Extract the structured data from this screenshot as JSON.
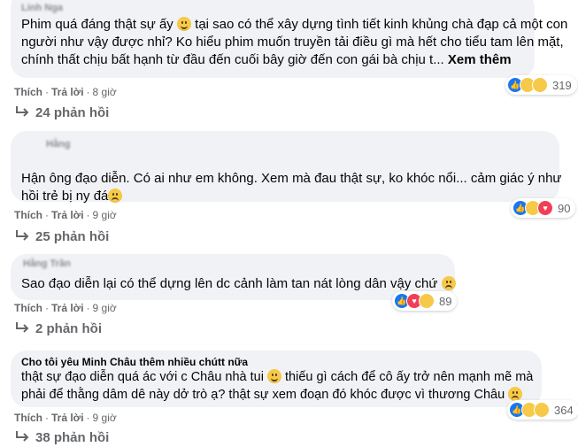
{
  "comments": [
    {
      "author": "Linh Nga",
      "author_blurred": true,
      "text_lines": [
        "Phim quá đáng thật sự ấy",
        "tại sao có thể xây dựng tình tiết kinh khủng chà đạp cả một con",
        "người như vậy được nhỉ? Ko hiểu phim muốn truyền tải điều gì mà hết cho tiểu tam lên mặt,",
        "chính thất chịu bất hạnh từ đầu đến cuối bây giờ đến con gái bà chịu t..."
      ],
      "see_more": "Xem thêm",
      "like_label": "Thích",
      "reply_label": "Trả lời",
      "time": "8 giờ",
      "reaction_count": "319",
      "reaction_types": [
        "like",
        "haha",
        "sad"
      ],
      "replies_label": "24 phản hồi"
    },
    {
      "author": "Hằng",
      "author_blurred": true,
      "text_lines": [
        "Hận ông đạo diễn. Có ai như em không. Xem mà đau thật sự, ko khóc nổi... cảm giác ý như",
        "hồi trẻ bị ny đá"
      ],
      "like_label": "Thích",
      "reply_label": "Trả lời",
      "time": "9 giờ",
      "reaction_count": "90",
      "reaction_types": [
        "like",
        "sad",
        "love"
      ],
      "replies_label": "25 phản hồi"
    },
    {
      "author": "Hằng Trần",
      "author_blurred": true,
      "text_lines": [
        "Sao đạo diễn lại có thể dựng lên dc cảnh làm tan nát lòng dân vậy chứ"
      ],
      "like_label": "Thích",
      "reply_label": "Trả lời",
      "time": "9 giờ",
      "reaction_count": "89",
      "reaction_types": [
        "like",
        "love",
        "sad"
      ],
      "replies_label": "2 phản hồi"
    },
    {
      "author": "Cho tôi yêu Minh Châu thêm nhiều chútt nữa",
      "author_blurred": false,
      "text_lines": [
        "thật sự đạo diễn quá ác với c Châu nhà tui",
        "thiếu gì cách để cô ấy trở nên mạnh mẽ mà",
        "phải để thằng dâm dê này dở trò ạ? thật sự xem đoạn đó khóc được vì thương Châu"
      ],
      "like_label": "Thích",
      "reply_label": "Trả lời",
      "time": "9 giờ",
      "reaction_count": "364",
      "reaction_types": [
        "like",
        "sad",
        "haha"
      ],
      "replies_label": "38 phản hồi"
    }
  ],
  "colors": {
    "bubble": "#f0f2f5",
    "meta_text": "#65676b",
    "like_blue": "#1877f2",
    "love_red": "#f33e58",
    "emoji_yellow": "#f7c948"
  }
}
